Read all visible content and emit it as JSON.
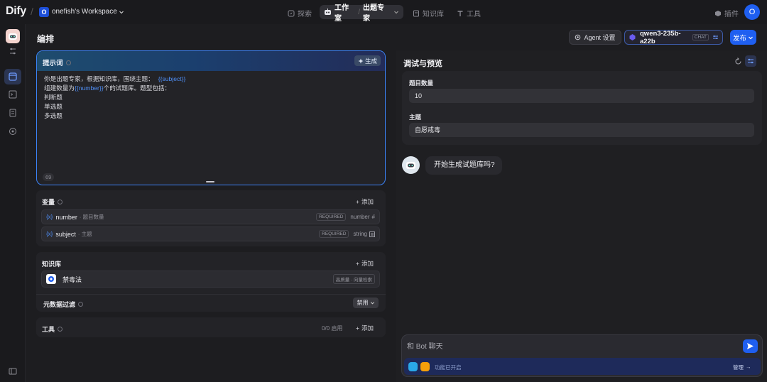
{
  "topbar": {
    "logo": "Dify",
    "workspace_initial": "O",
    "workspace_name": "onefish's Workspace",
    "nav_explore": "探索",
    "nav_studio": "工作室",
    "nav_studio_app": "出题专家",
    "nav_knowledge": "知识库",
    "nav_tools": "工具",
    "plugins": "插件",
    "avatar": "O"
  },
  "main": {
    "title": "编排",
    "agent_settings": "Agent 设置",
    "model_name": "qwen3-235b-a22b",
    "model_mode": "CHAT",
    "publish": "发布"
  },
  "prompt": {
    "title": "提示词",
    "generate": "生成",
    "line1_prefix": "你是出题专家，根据知识库，围绕主题：",
    "line1_var": "{{subject}}",
    "line2_prefix": "组建数量为",
    "line2_var": "{{number}}",
    "line2_suffix": "个的试题库。题型包括：",
    "line3": "判断题",
    "line4": "单选题",
    "line5": "多选题",
    "char_count": "69"
  },
  "variables": {
    "title": "变量",
    "add": "添加",
    "items": [
      {
        "name": "number",
        "label": "题目数量",
        "required": "REQUIRED",
        "type": "number"
      },
      {
        "name": "subject",
        "label": "主题",
        "required": "REQUIRED",
        "type": "string"
      }
    ]
  },
  "knowledge": {
    "title": "知识库",
    "add": "添加",
    "item_name": "禁毒法",
    "item_tag": "高质量 · 向量检索"
  },
  "metadata_filter": {
    "title": "元数据过滤",
    "value": "禁用"
  },
  "tools": {
    "title": "工具",
    "count": "0/0 启用",
    "add": "添加"
  },
  "debug": {
    "title": "调试与预览",
    "field1_label": "题目数量",
    "field1_value": "10",
    "field2_label": "主题",
    "field2_value": "自愿戒毒",
    "bot_message": "开始生成试题库吗?",
    "chat_placeholder": "和 Bot 聊天",
    "features_enabled": "功能已开启",
    "manage": "管理"
  },
  "colors": {
    "accent": "#1f5ff0",
    "variable": "#4f8ff7",
    "background": "#1d1d20"
  }
}
